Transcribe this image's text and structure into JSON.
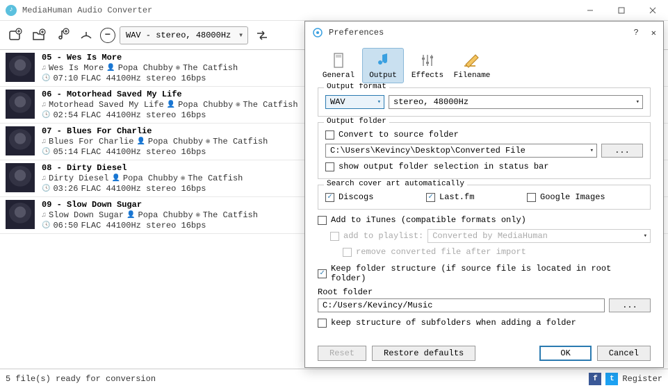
{
  "app": {
    "title": "MediaHuman Audio Converter"
  },
  "toolbar": {
    "format": "WAV - stereo, 48000Hz"
  },
  "tracks": [
    {
      "num": "05",
      "title": "Wes Is More",
      "track_name": "Wes Is More",
      "artist": "Popa Chubby",
      "album": "The Catfish",
      "time": "07:10",
      "codec": "FLAC 44100Hz stereo 16bps"
    },
    {
      "num": "06",
      "title": "Motorhead Saved My Life",
      "track_name": "Motorhead Saved My Life",
      "artist": "Popa Chubby",
      "album": "The Catfish",
      "time": "02:54",
      "codec": "FLAC 44100Hz stereo 16bps"
    },
    {
      "num": "07",
      "title": "Blues For Charlie",
      "track_name": "Blues For Charlie",
      "artist": "Popa Chubby",
      "album": "The Catfish",
      "time": "05:14",
      "codec": "FLAC 44100Hz stereo 16bps"
    },
    {
      "num": "08",
      "title": "Dirty Diesel",
      "track_name": "Dirty Diesel",
      "artist": "Popa Chubby",
      "album": "The Catfish",
      "time": "03:26",
      "codec": "FLAC 44100Hz stereo 16bps"
    },
    {
      "num": "09",
      "title": "Slow Down Sugar",
      "track_name": "Slow Down Sugar",
      "artist": "Popa Chubby",
      "album": "The Catfish",
      "time": "06:50",
      "codec": "FLAC 44100Hz stereo 16bps"
    }
  ],
  "status": {
    "text": "5 file(s) ready for conversion",
    "register": "Register"
  },
  "prefs": {
    "title": "Preferences",
    "tabs": {
      "general": "General",
      "output": "Output",
      "effects": "Effects",
      "filename": "Filename"
    },
    "output_format": {
      "legend": "Output format",
      "codec": "WAV",
      "params": "stereo, 48000Hz"
    },
    "output_folder": {
      "legend": "Output folder",
      "convert_to_source": "Convert to source folder",
      "path": "C:\\Users\\Kevincy\\Desktop\\Converted File",
      "browse": "...",
      "show_in_status": "show output folder selection in status bar"
    },
    "cover_art": {
      "legend": "Search cover art automatically",
      "discogs": "Discogs",
      "lastfm": "Last.fm",
      "google": "Google Images"
    },
    "itunes": {
      "add": "Add to iTunes (compatible formats only)",
      "playlist_label": "add to playlist:",
      "playlist_value": "Converted by MediaHuman",
      "remove_after": "remove converted file after import"
    },
    "structure": {
      "keep": "Keep folder structure (if source file is located in root folder)",
      "root_label": "Root folder",
      "root_path": "C:/Users/Kevincy/Music",
      "browse": "...",
      "keep_sub": "keep structure of subfolders when adding a folder"
    },
    "footer": {
      "reset": "Reset",
      "restore": "Restore defaults",
      "ok": "OK",
      "cancel": "Cancel"
    }
  }
}
